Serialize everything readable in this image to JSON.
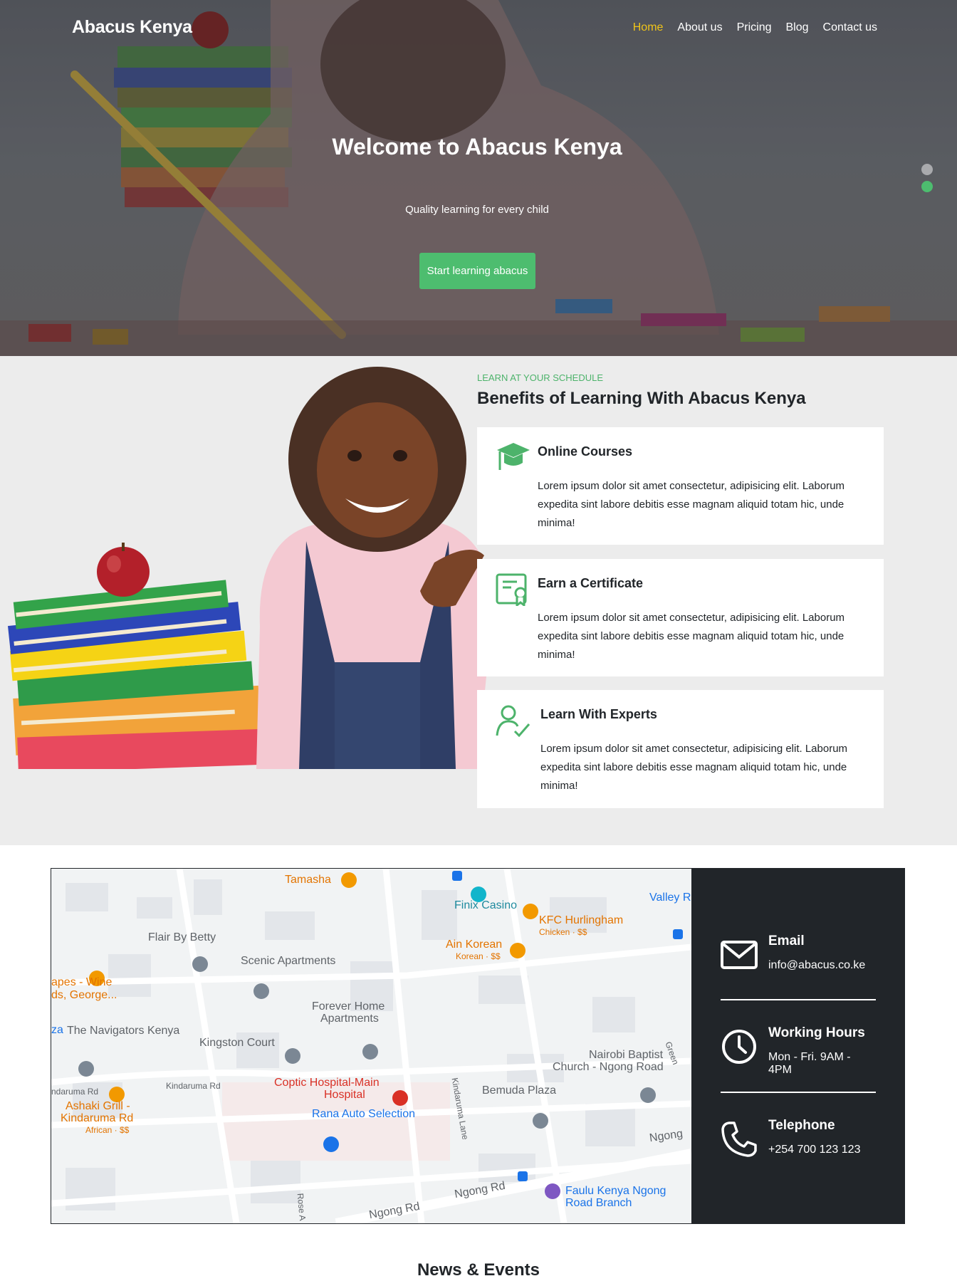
{
  "header": {
    "brand": "Abacus Kenya",
    "nav": [
      {
        "label": "Home",
        "active": true
      },
      {
        "label": "About us"
      },
      {
        "label": "Pricing"
      },
      {
        "label": "Blog"
      },
      {
        "label": "Contact us"
      }
    ]
  },
  "hero": {
    "title": "Welcome to Abacus Kenya",
    "subtitle": "Quality learning for every child",
    "cta": "Start learning abacus",
    "slides_total": 2,
    "active_slide": 2
  },
  "benefits": {
    "eyebrow": "LEARN AT YOUR SCHEDULE",
    "title": "Benefits of Learning With Abacus Kenya",
    "cards": [
      {
        "icon": "graduation-cap-icon",
        "title": "Online Courses",
        "text": "Lorem ipsum dolor sit amet consectetur, adipisicing elit. Laborum expedita sint labore debitis esse magnam aliquid totam hic, unde minima!"
      },
      {
        "icon": "certificate-icon",
        "title": "Earn a Certificate",
        "text": "Lorem ipsum dolor sit amet consectetur, adipisicing elit. Laborum expedita sint labore debitis esse magnam aliquid totam hic, unde minima!"
      },
      {
        "icon": "expert-user-check-icon",
        "title": "Learn With Experts",
        "text": "Lorem ipsum dolor sit amet consectetur, adipisicing elit. Laborum expedita sint labore debitis esse magnam aliquid totam hic, unde minima!"
      }
    ]
  },
  "map": {
    "labels": {
      "tamasha": "Tamasha",
      "finix": "Finix Casino",
      "valley": "Valley R",
      "kfc": "KFC Hurlingham",
      "kfc_sub": "Chicken · $$",
      "ain": "Ain Korean",
      "ain_sub": "Korean · $$",
      "flair": "Flair By Betty",
      "scenic": "Scenic Apartments",
      "grapes1": "apes - Wine",
      "grapes2": "ds, George...",
      "forever1": "Forever Home",
      "forever2": "Apartments",
      "za": "za",
      "navigators": "The Navigators Kenya",
      "kingston": "Kingston Court",
      "nbc1": "Nairobi Baptist",
      "nbc2": "Church - Ngong Road",
      "greer": "Green",
      "kind1": "ndaruma Rd",
      "kind2": "Kindaruma Rd",
      "kind_lane": "Kindaruma Lane",
      "coptic1": "Coptic Hospital-Main",
      "coptic2": "Hospital",
      "bemuda": "Bemuda Plaza",
      "ashaki1": "Ashaki Grill -",
      "ashaki2": "Kindaruma Rd",
      "ashaki_sub": "African · $$",
      "rana": "Rana Auto Selection",
      "ngong": "Ngong",
      "ngong_rd": "Ngong Rd",
      "ngong_rd2": "Ngong Rd",
      "rose": "Rose A",
      "faulu1": "Faulu Kenya Ngong",
      "faulu2": "Road Branch"
    }
  },
  "contact": {
    "email_label": "Email",
    "email_value": "info@abacus.co.ke",
    "hours_label": "Working Hours",
    "hours_value": "Mon - Fri. 9AM - 4PM",
    "phone_label": "Telephone",
    "phone_value": "+254 700 123 123"
  },
  "news": {
    "title": "News & Events"
  },
  "colors": {
    "accent": "#4dbd6f",
    "nav_active": "#f0c419",
    "dark": "#212529"
  }
}
